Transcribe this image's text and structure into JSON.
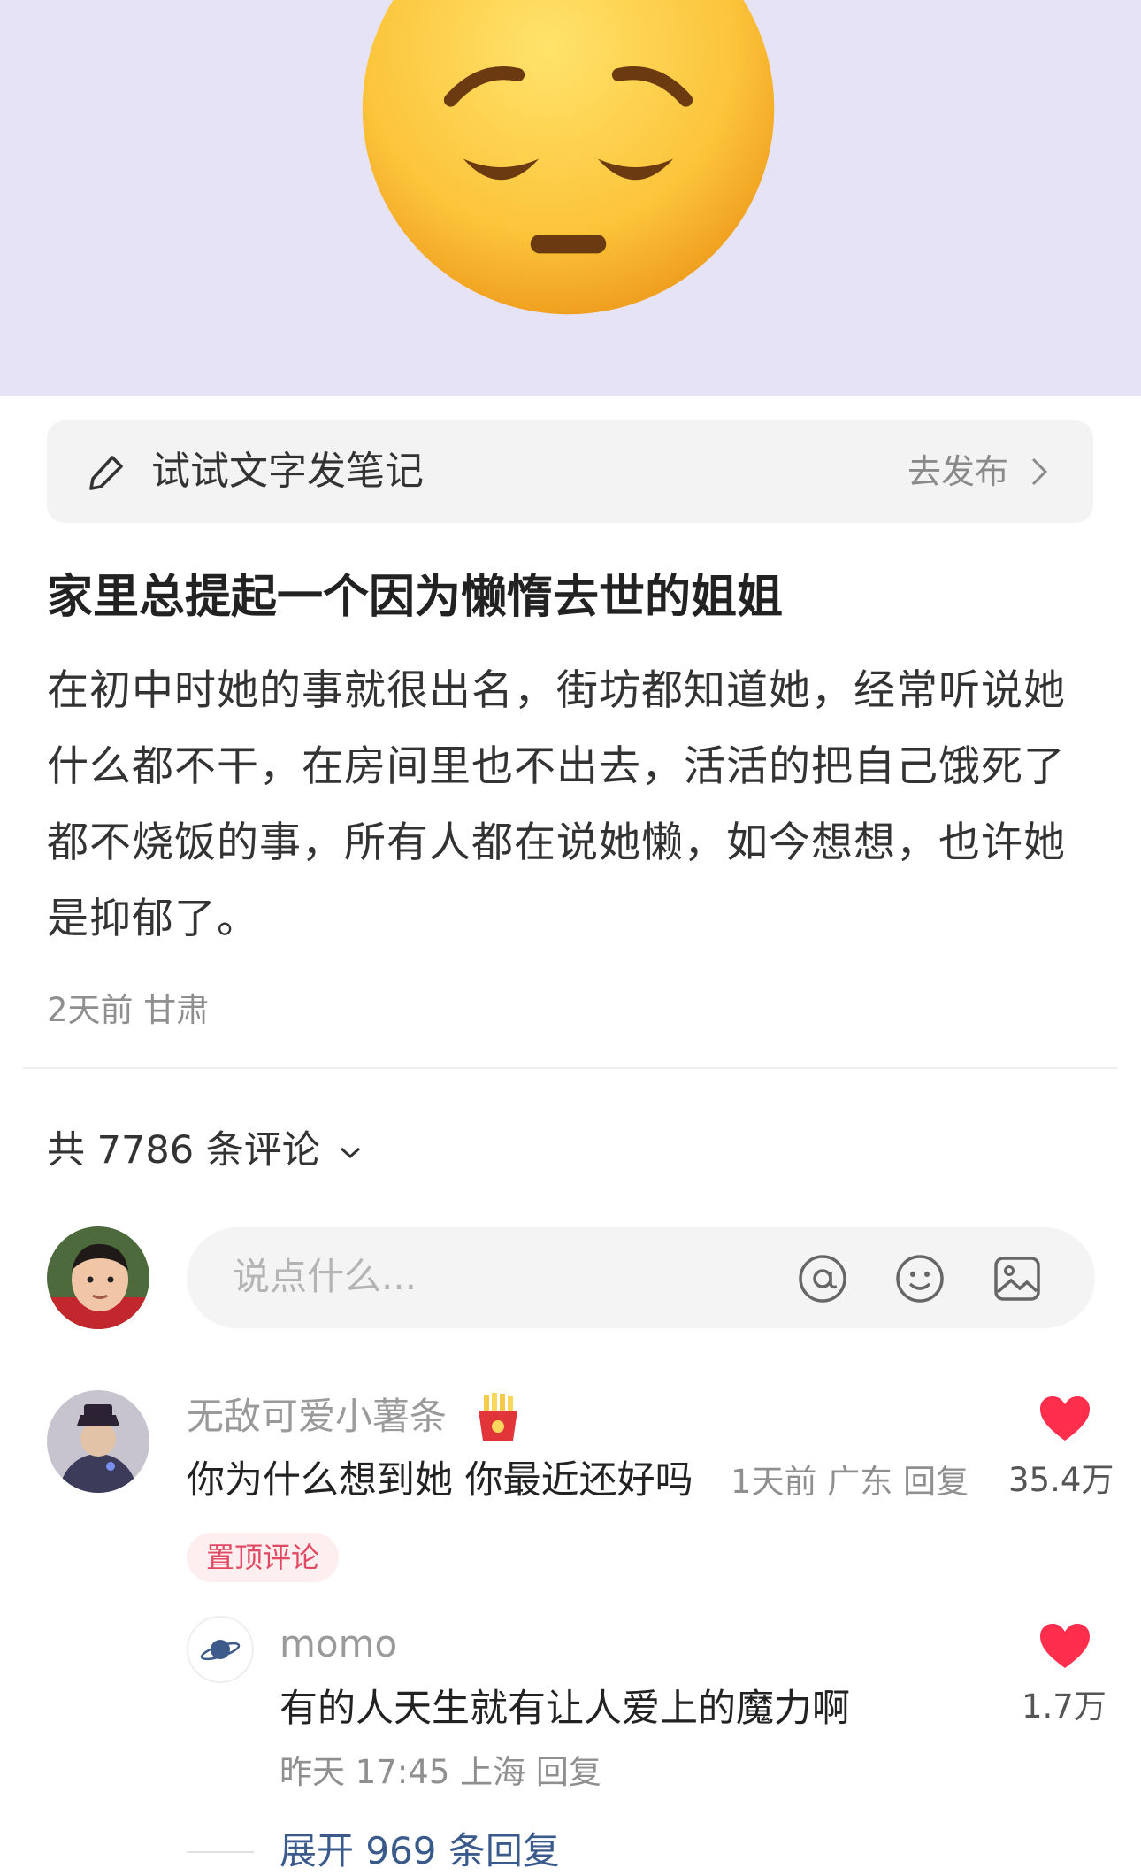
{
  "hero": {
    "background_color": "#e6e3f6",
    "emoji_icon": "pensive-face-emoji"
  },
  "cta": {
    "label": "试试文字发笔记",
    "go_label": "去发布"
  },
  "post": {
    "title": "家里总提起一个因为懒惰去世的姐姐",
    "body": "在初中时她的事就很出名，街坊都知道她，经常听说她什么都不干，在房间里也不出去，活活的把自己饿死了都不烧饭的事，所有人都在说她懒，如今想想，也许她是抑郁了。",
    "meta": "2天前 甘肃"
  },
  "comments_header": {
    "label": "共 7786 条评论"
  },
  "comment_input": {
    "placeholder": "说点什么..."
  },
  "comment": {
    "name": "无敌可爱小薯条",
    "text": "你为什么想到她 你最近还好吗",
    "meta": "1天前 广东 回复",
    "likes": "35.4万",
    "tag": "置顶评论"
  },
  "reply": {
    "name": "momo",
    "text": "有的人天生就有让人爱上的魔力啊",
    "meta": "昨天 17:45 上海 回复",
    "likes": "1.7万"
  },
  "expand": {
    "label": "展开 969 条回复"
  },
  "colors": {
    "heart": "#ff2e4d",
    "link": "#3b5a8c",
    "tag_text": "#e24a63"
  }
}
